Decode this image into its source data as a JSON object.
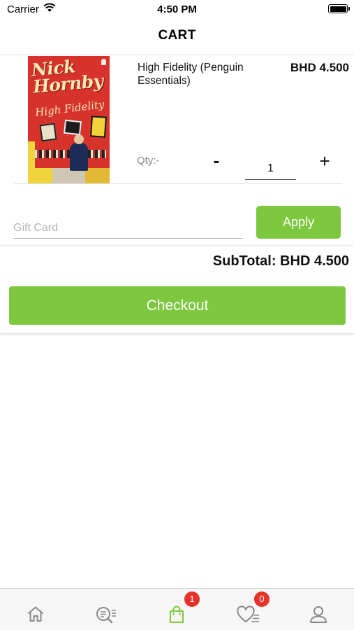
{
  "status_bar": {
    "carrier": "Carrier",
    "time": "4:50 PM"
  },
  "nav": {
    "title": "CART"
  },
  "cart_item": {
    "cover_author": "Nick Hornby",
    "cover_title": "High Fidelity",
    "title": "High Fidelity (Penguin Essentials)",
    "price": "BHD 4.500",
    "qty_label": "Qty:-",
    "minus_label": "-",
    "plus_label": "+",
    "quantity": "1"
  },
  "gift_card": {
    "placeholder": "Gift Card",
    "apply_label": "Apply"
  },
  "summary": {
    "subtotal_text": "SubTotal: BHD 4.500",
    "checkout_label": "Checkout"
  },
  "tabbar": {
    "items": [
      {
        "icon": "home-icon",
        "active": false
      },
      {
        "icon": "search-icon",
        "active": false
      },
      {
        "icon": "shopping-bag-icon",
        "active": true,
        "badge": "1"
      },
      {
        "icon": "wishlist-icon",
        "active": false,
        "badge": "0"
      },
      {
        "icon": "profile-icon",
        "active": false
      }
    ]
  },
  "colors": {
    "accent": "#7ec83f",
    "badge": "#e5332a",
    "icon_inactive": "#8a8a8a"
  }
}
